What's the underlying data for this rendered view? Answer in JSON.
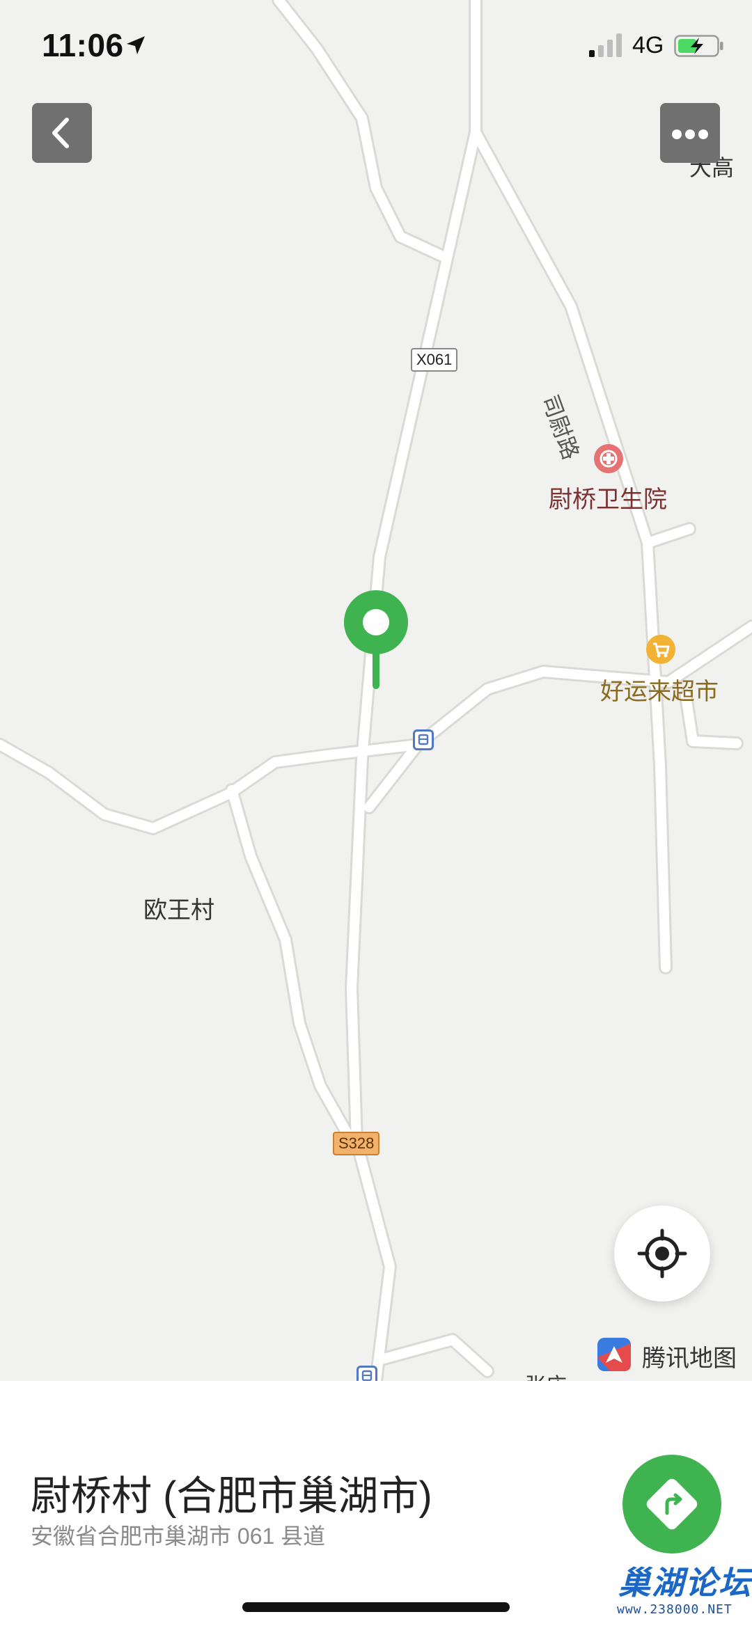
{
  "status_bar": {
    "time": "11:06",
    "network": "4G"
  },
  "top_bar": {
    "back_icon": "chevron-left-icon",
    "more_icon": "ellipsis-icon"
  },
  "map": {
    "labels": {
      "dagao": "大高",
      "siwei_road": "司尉路",
      "hospital": "尉桥卫生院",
      "supermarket": "好运来超市",
      "ouwang_village": "欧王村",
      "zhangzhuang": "张庄"
    },
    "road_shields": {
      "x061": "X061",
      "s328": "S328"
    },
    "colors": {
      "background": "#f1f1ef",
      "road": "#ffffff",
      "marker": "#3fb34f",
      "hospital": "#e57373",
      "supermarket": "#f2b233"
    },
    "brand": "腾讯地图"
  },
  "place": {
    "name": "尉桥村 (合肥市巢湖市)",
    "address": "安徽省合肥市巢湖市 061 县道"
  },
  "watermark": {
    "title": "巢湖论坛",
    "url": "www.238000.NET"
  }
}
